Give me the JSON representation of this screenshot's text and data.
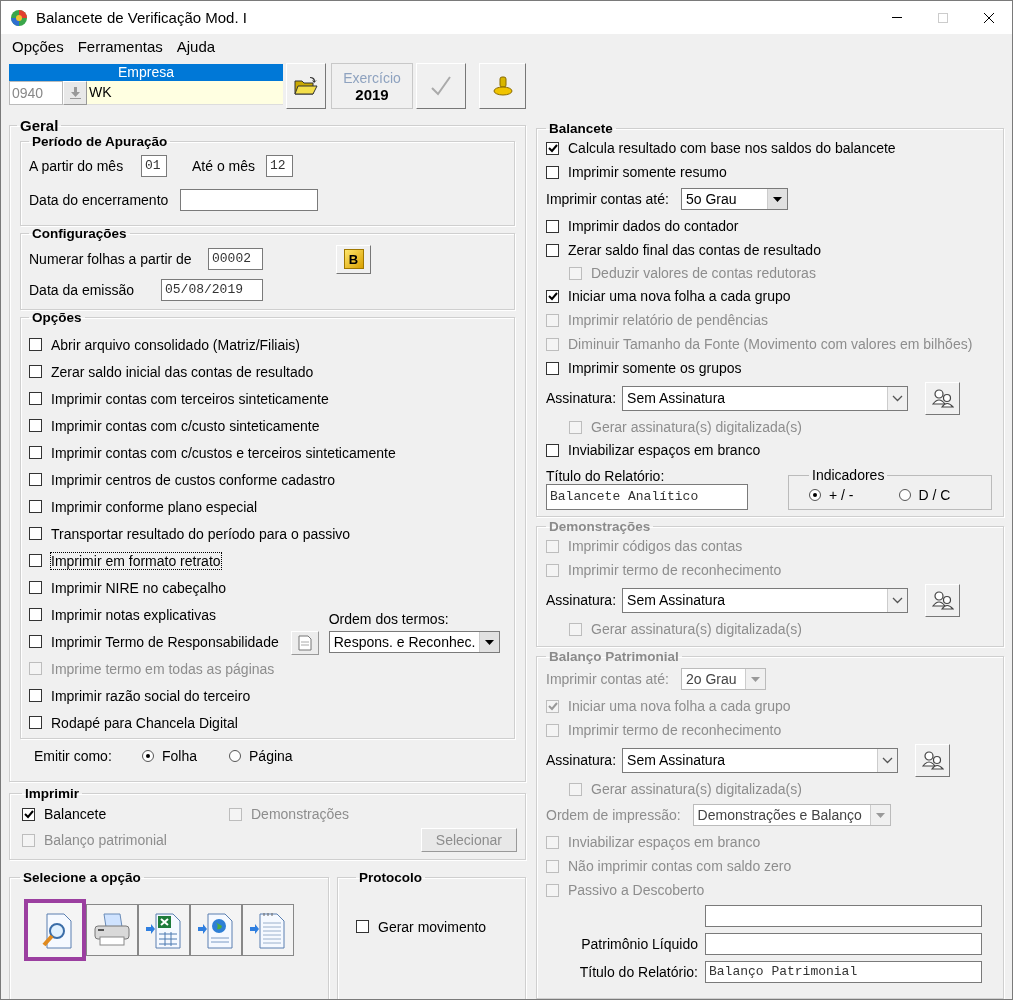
{
  "window": {
    "title": "Balancete de Verificação Mod. I"
  },
  "menu": [
    "Opções",
    "Ferramentas",
    "Ajuda"
  ],
  "toolbar": {
    "company_label": "Empresa",
    "company_code": "0940",
    "company_name": "WK",
    "year_label": "Exercício",
    "year": "2019"
  },
  "geral": {
    "title": "Geral",
    "periodo": {
      "title": "Período de Apuração",
      "from_label": "A partir do mês",
      "from_value": "01",
      "to_label": "Até o mês",
      "to_value": "12",
      "closing_label": "Data do encerramento"
    },
    "config": {
      "title": "Configurações",
      "pages_label": "Numerar folhas a partir de",
      "pages_value": "00002",
      "b_button": "B",
      "date_label": "Data da emissão",
      "date_value": "05/08/2019"
    },
    "opcoes": {
      "title": "Opções",
      "items": [
        {
          "kind": "checkbox",
          "label": "Abrir arquivo consolidado (Matriz/Filiais)",
          "checked": false,
          "disabled": false,
          "focused": false
        },
        {
          "kind": "checkbox",
          "label": "Zerar saldo inicial das contas de resultado",
          "checked": false,
          "disabled": false,
          "focused": false
        },
        {
          "kind": "checkbox",
          "label": "Imprimir contas com terceiros sinteticamente",
          "checked": false,
          "disabled": false,
          "focused": false
        },
        {
          "kind": "checkbox",
          "label": "Imprimir contas com c/custo sinteticamente",
          "checked": false,
          "disabled": false,
          "focused": false
        },
        {
          "kind": "checkbox",
          "label": "Imprimir contas com c/custos e terceiros sinteticamente",
          "checked": false,
          "disabled": false,
          "focused": false
        },
        {
          "kind": "checkbox",
          "label": "Imprimir centros de custos conforme cadastro",
          "checked": false,
          "disabled": false,
          "focused": false
        },
        {
          "kind": "checkbox",
          "label": "Imprimir conforme plano especial",
          "checked": false,
          "disabled": false,
          "focused": false
        },
        {
          "kind": "checkbox",
          "label": "Transportar resultado do período para o passivo",
          "checked": false,
          "disabled": false,
          "focused": false
        },
        {
          "kind": "checkbox",
          "label": "Imprimir em formato retrato",
          "checked": false,
          "disabled": false,
          "focused": true
        },
        {
          "kind": "checkbox",
          "label": "Imprimir NIRE no cabeçalho",
          "checked": false,
          "disabled": false,
          "focused": false
        },
        {
          "kind": "checkbox",
          "label": "Imprimir notas explicativas",
          "checked": false,
          "disabled": false,
          "focused": false
        },
        {
          "kind": "checkbox_terms",
          "label": "Imprimir Termo de Responsabilidade",
          "checked": false,
          "disabled": false,
          "focused": false,
          "order_label": "Ordem dos termos:",
          "order_value": "Respons. e Reconhec."
        },
        {
          "kind": "checkbox",
          "label": "Imprime termo em todas as páginas",
          "checked": false,
          "disabled": true,
          "focused": false
        },
        {
          "kind": "checkbox",
          "label": "Imprimir razão social do terceiro",
          "checked": false,
          "disabled": false,
          "focused": false
        },
        {
          "kind": "checkbox",
          "label": "Rodapé para Chancela Digital",
          "checked": false,
          "disabled": false,
          "focused": false
        }
      ]
    },
    "emitir": {
      "label": "Emitir como:",
      "options": [
        {
          "label": "Folha",
          "selected": true
        },
        {
          "label": "Página",
          "selected": false
        }
      ]
    }
  },
  "imprimir": {
    "title": "Imprimir",
    "items": [
      {
        "label": "Balancete",
        "checked": true,
        "disabled": false
      },
      {
        "label": "Demonstrações",
        "checked": false,
        "disabled": true
      },
      {
        "label": "Balanço patrimonial",
        "checked": false,
        "disabled": true
      }
    ],
    "button": {
      "label": "Selecionar",
      "disabled": true
    }
  },
  "selecione": {
    "title": "Selecione a opção",
    "buttons": [
      {
        "kind": "preview",
        "selected": true
      },
      {
        "kind": "print",
        "selected": false
      },
      {
        "kind": "spreadsheet",
        "selected": false
      },
      {
        "kind": "web",
        "selected": false
      },
      {
        "kind": "text",
        "selected": false
      }
    ]
  },
  "protocolo": {
    "title": "Protocolo",
    "item": {
      "label": "Gerar movimento",
      "checked": false,
      "disabled": false
    }
  },
  "balancete": {
    "title": "Balancete",
    "disabled": false,
    "items": [
      {
        "kind": "checkbox",
        "label": "Calcula resultado com base nos saldos do balancete",
        "checked": true,
        "disabled": false
      },
      {
        "kind": "checkbox",
        "label": "Imprimir somente resumo",
        "checked": false,
        "disabled": false
      },
      {
        "kind": "select",
        "label": "Imprimir contas até:",
        "value": "5o Grau",
        "disabled": false
      },
      {
        "kind": "checkbox",
        "label": "Imprimir dados do contador",
        "checked": false,
        "disabled": false
      },
      {
        "kind": "checkbox",
        "label": "Zerar saldo final das contas de resultado",
        "checked": false,
        "disabled": false,
        "children": [
          {
            "kind": "checkbox",
            "label": "Deduzir valores de contas redutoras",
            "checked": false,
            "disabled": true
          }
        ]
      },
      {
        "kind": "checkbox",
        "label": "Iniciar uma nova folha a cada grupo",
        "checked": true,
        "disabled": false
      },
      {
        "kind": "checkbox",
        "label": "Imprimir relatório de pendências",
        "checked": false,
        "disabled": true
      },
      {
        "kind": "checkbox",
        "label": "Diminuir Tamanho da Fonte (Movimento com valores em bilhões)",
        "checked": false,
        "disabled": true
      },
      {
        "kind": "checkbox",
        "label": "Imprimir somente os grupos",
        "checked": false,
        "disabled": false
      },
      {
        "kind": "signature",
        "label": "Assinatura:",
        "value": "Sem Assinatura",
        "disabled": false,
        "children": [
          {
            "kind": "checkbox",
            "label": "Gerar assinatura(s) digitalizada(s)",
            "checked": false,
            "disabled": true
          }
        ]
      },
      {
        "kind": "checkbox",
        "label": "Inviabilizar espaços em branco",
        "checked": false,
        "disabled": false
      }
    ],
    "report_title": {
      "label": "Título do Relatório:",
      "value": "Balancete Analítico"
    },
    "indicators": {
      "title": "Indicadores",
      "options": [
        {
          "label": "+ / -",
          "selected": true
        },
        {
          "label": "D / C",
          "selected": false
        }
      ]
    }
  },
  "demonstracoes": {
    "title": "Demonstrações",
    "disabled": true,
    "items": [
      {
        "kind": "checkbox",
        "label": "Imprimir códigos das contas",
        "checked": false,
        "disabled": true
      },
      {
        "kind": "checkbox",
        "label": "Imprimir termo de reconhecimento",
        "checked": false,
        "disabled": true
      },
      {
        "kind": "signature",
        "label": "Assinatura:",
        "value": "Sem Assinatura",
        "disabled": false,
        "children": [
          {
            "kind": "checkbox",
            "label": "Gerar assinatura(s) digitalizada(s)",
            "checked": false,
            "disabled": true
          }
        ]
      }
    ]
  },
  "balanco": {
    "title": "Balanço Patrimonial",
    "disabled": true,
    "items": [
      {
        "kind": "select",
        "label": "Imprimir contas até:",
        "value": "2o Grau",
        "disabled": true
      },
      {
        "kind": "checkbox",
        "label": "Iniciar uma nova folha a cada grupo",
        "checked": true,
        "disabled": true
      },
      {
        "kind": "checkbox",
        "label": "Imprimir termo de reconhecimento",
        "checked": false,
        "disabled": true
      },
      {
        "kind": "signature",
        "label": "Assinatura:",
        "value": "Sem Assinatura",
        "disabled": false,
        "children": [
          {
            "kind": "checkbox",
            "label": "Gerar assinatura(s) digitalizada(s)",
            "checked": false,
            "disabled": true
          }
        ]
      },
      {
        "kind": "select",
        "label": "Ordem de impressão:",
        "value": "Demonstrações e Balanço",
        "disabled": true
      },
      {
        "kind": "checkbox",
        "label": "Inviabilizar espaços em branco",
        "checked": false,
        "disabled": true
      },
      {
        "kind": "checkbox",
        "label": "Não imprimir contas com saldo zero",
        "checked": false,
        "disabled": true
      },
      {
        "kind": "checkbox",
        "label": "Passivo a Descoberto",
        "checked": false,
        "disabled": true
      }
    ],
    "fields": [
      {
        "kind": "text_field"
      },
      {
        "kind": "text_field",
        "label": "Patrimônio Líquido"
      },
      {
        "kind": "text_field",
        "label": "Título do Relatório:",
        "value": "Balanço Patrimonial"
      }
    ]
  }
}
